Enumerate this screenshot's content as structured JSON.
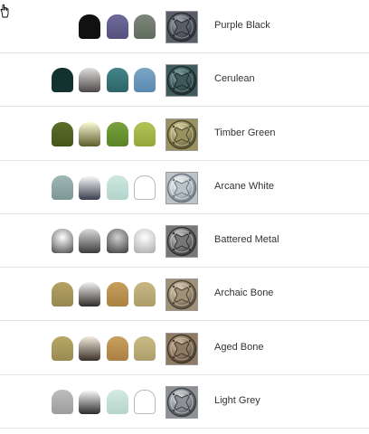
{
  "cursor_icon": "hand-pointer-icon",
  "colors": [
    {
      "name": "Purple Black",
      "pots": [
        {
          "name": "black-pot",
          "bg": "#111111"
        },
        {
          "name": "purple-pot",
          "bg": "linear-gradient(#6e6a9a,#55507e)"
        },
        {
          "name": "grey-green-pot",
          "bg": "linear-gradient(#7f877c,#626b60)"
        }
      ],
      "swatch": {
        "base": "#595d67",
        "light": "#b4b9c2",
        "dark": "#2a2c31"
      }
    },
    {
      "name": "Cerulean",
      "pots": [
        {
          "name": "dark-teal-pot",
          "bg": "#12312f"
        },
        {
          "name": "gradient-pot",
          "bg": "linear-gradient(#e0dede,#504848)"
        },
        {
          "name": "teal-pot",
          "bg": "linear-gradient(#44858a,#2e6468)"
        },
        {
          "name": "blue-pot",
          "bg": "linear-gradient(#7ba7c8,#5b88ac)"
        }
      ],
      "swatch": {
        "base": "#3f5a5c",
        "light": "#8fb1b4",
        "dark": "#1c2a2b"
      }
    },
    {
      "name": "Timber Green",
      "pots": [
        {
          "name": "olive-pot",
          "bg": "linear-gradient(#5b6e2a,#44551b)"
        },
        {
          "name": "gradient-pot",
          "bg": "linear-gradient(#fafad6,#5c5e2b)"
        },
        {
          "name": "green-pot",
          "bg": "linear-gradient(#79a23c,#5a832a)"
        },
        {
          "name": "lime-pot",
          "bg": "linear-gradient(#b3c456,#94a73c)"
        }
      ],
      "swatch": {
        "base": "#9a9160",
        "light": "#ece6bc",
        "dark": "#4e4a2e"
      }
    },
    {
      "name": "Arcane White",
      "pots": [
        {
          "name": "grey-teal-pot",
          "bg": "linear-gradient(#9fb7b7,#7b9796)"
        },
        {
          "name": "gradient-pot",
          "bg": "linear-gradient(#ffffff,#3a3d4e)"
        },
        {
          "name": "pale-mint-pot",
          "bg": "linear-gradient(#cfe8e1,#b1d4cb)"
        },
        {
          "name": "white-pot",
          "bg": "#ffffff",
          "outline": true
        }
      ],
      "swatch": {
        "base": "#b9c3c9",
        "light": "#ffffff",
        "dark": "#6d767c"
      }
    },
    {
      "name": "Battered Metal",
      "pots": [
        {
          "name": "silver-pot",
          "bg": "radial-gradient(circle at 50% 35%,#ffffff,#4a4a4a)"
        },
        {
          "name": "gradient-pot",
          "bg": "linear-gradient(#dcdcdc,#3c3c3c)"
        },
        {
          "name": "steel-pot",
          "bg": "radial-gradient(circle at 50% 35%,#d0d0d0,#3a3a3a)"
        },
        {
          "name": "light-silver-pot",
          "bg": "radial-gradient(circle at 50% 35%,#ffffff,#a9a9a9)"
        }
      ],
      "swatch": {
        "base": "#777777",
        "light": "#d8d8d8",
        "dark": "#333333"
      }
    },
    {
      "name": "Archaic Bone",
      "pots": [
        {
          "name": "khaki-pot",
          "bg": "linear-gradient(#b5a364,#978650)"
        },
        {
          "name": "gradient-pot",
          "bg": "linear-gradient(#f2f2f2,#2e2b28)"
        },
        {
          "name": "tan-pot",
          "bg": "linear-gradient(#c79f5d,#a98142)"
        },
        {
          "name": "beige-pot",
          "bg": "linear-gradient(#c8b884,#ad9d69)"
        }
      ],
      "swatch": {
        "base": "#a09076",
        "light": "#e8dcc8",
        "dark": "#4e463a"
      }
    },
    {
      "name": "Aged Bone",
      "pots": [
        {
          "name": "khaki-pot",
          "bg": "linear-gradient(#b8a866,#9a8a4e)"
        },
        {
          "name": "gradient-pot",
          "bg": "linear-gradient(#f5ebe0,#3b2e26)"
        },
        {
          "name": "tan-pot",
          "bg": "linear-gradient(#c9a05e,#a98042)"
        },
        {
          "name": "beige-pot",
          "bg": "linear-gradient(#c9ba86,#ae9e6b)"
        }
      ],
      "swatch": {
        "base": "#8f7a62",
        "light": "#dacab4",
        "dark": "#44392d"
      }
    },
    {
      "name": "Light Grey",
      "pots": [
        {
          "name": "grey-pot",
          "bg": "linear-gradient(#bdbdbd,#9c9c9c)"
        },
        {
          "name": "gradient-pot",
          "bg": "linear-gradient(#ffffff,#2c2c2c)"
        },
        {
          "name": "pale-mint-pot",
          "bg": "linear-gradient(#d2eae3,#b5d4cb)"
        },
        {
          "name": "white-pot",
          "bg": "#ffffff",
          "outline": true
        }
      ],
      "swatch": {
        "base": "#8d9196",
        "light": "#e6e8ea",
        "dark": "#3f4245"
      }
    }
  ]
}
